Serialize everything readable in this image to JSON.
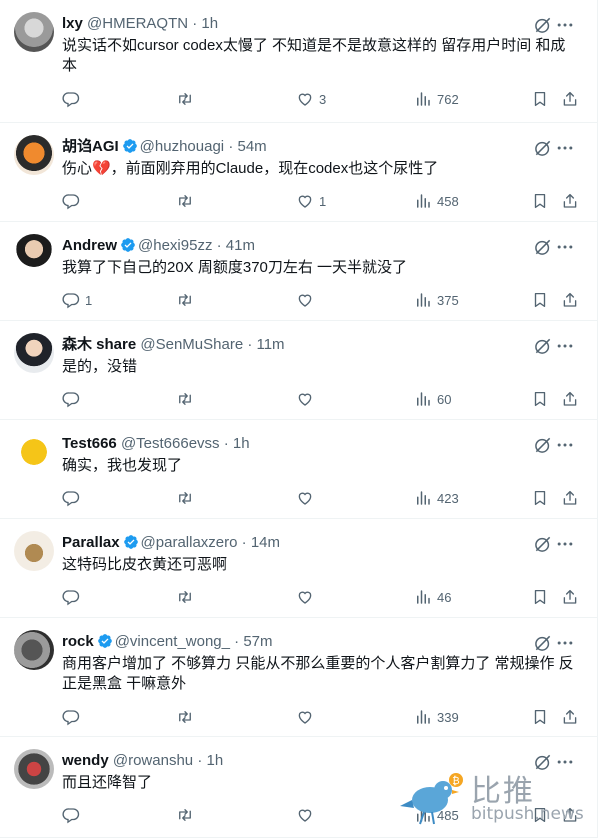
{
  "tweets": [
    {
      "name": "lxy",
      "verified": false,
      "handle": "@HMERAQTN",
      "time": "· 1h",
      "text": "说实话不如cursor codex太慢了 不知道是不是故意这样的 留存用户时间 和成本",
      "replies": "",
      "retweets": "",
      "likes": "3",
      "views": "762"
    },
    {
      "name": "胡诌AGI",
      "verified": true,
      "handle": "@huzhouagi",
      "time": "· 54m",
      "text": "伤心💔，前面刚弃用的Claude，现在codex也这个尿性了",
      "replies": "",
      "retweets": "",
      "likes": "1",
      "views": "458"
    },
    {
      "name": "Andrew",
      "verified": true,
      "handle": "@hexi95zz",
      "time": "· 41m",
      "text": "我算了下自己的20X 周额度370刀左右 一天半就没了",
      "replies": "1",
      "retweets": "",
      "likes": "",
      "views": "375"
    },
    {
      "name": "森木 share",
      "verified": false,
      "handle": "@SenMuShare",
      "time": "· 11m",
      "text": "是的，没错",
      "replies": "",
      "retweets": "",
      "likes": "",
      "views": "60"
    },
    {
      "name": "Test666",
      "verified": false,
      "handle": "@Test666evss",
      "time": "· 1h",
      "text": "确实，我也发现了",
      "replies": "",
      "retweets": "",
      "likes": "",
      "views": "423"
    },
    {
      "name": "Parallax",
      "verified": true,
      "handle": "@parallaxzero",
      "time": "· 14m",
      "text": "这特码比皮衣黄还可恶啊",
      "replies": "",
      "retweets": "",
      "likes": "",
      "views": "46"
    },
    {
      "name": "rock",
      "verified": true,
      "handle": "@vincent_wong_",
      "time": "· 57m",
      "text": "商用客户增加了 不够算力 只能从不那么重要的个人客户割算力了 常规操作 反正是黑盒 干嘛意外",
      "replies": "",
      "retweets": "",
      "likes": "",
      "views": "339"
    },
    {
      "name": "wendy",
      "verified": false,
      "handle": "@rowanshu",
      "time": "· 1h",
      "text": "而且还降智了",
      "replies": "",
      "retweets": "",
      "likes": "",
      "views": "485"
    }
  ],
  "watermark": {
    "cn": "比推",
    "en": "bitpush.news"
  },
  "colors": {
    "verified": "#1d9bf0",
    "muted": "#536471",
    "text": "#0f1419",
    "divider": "#eff3f4"
  }
}
